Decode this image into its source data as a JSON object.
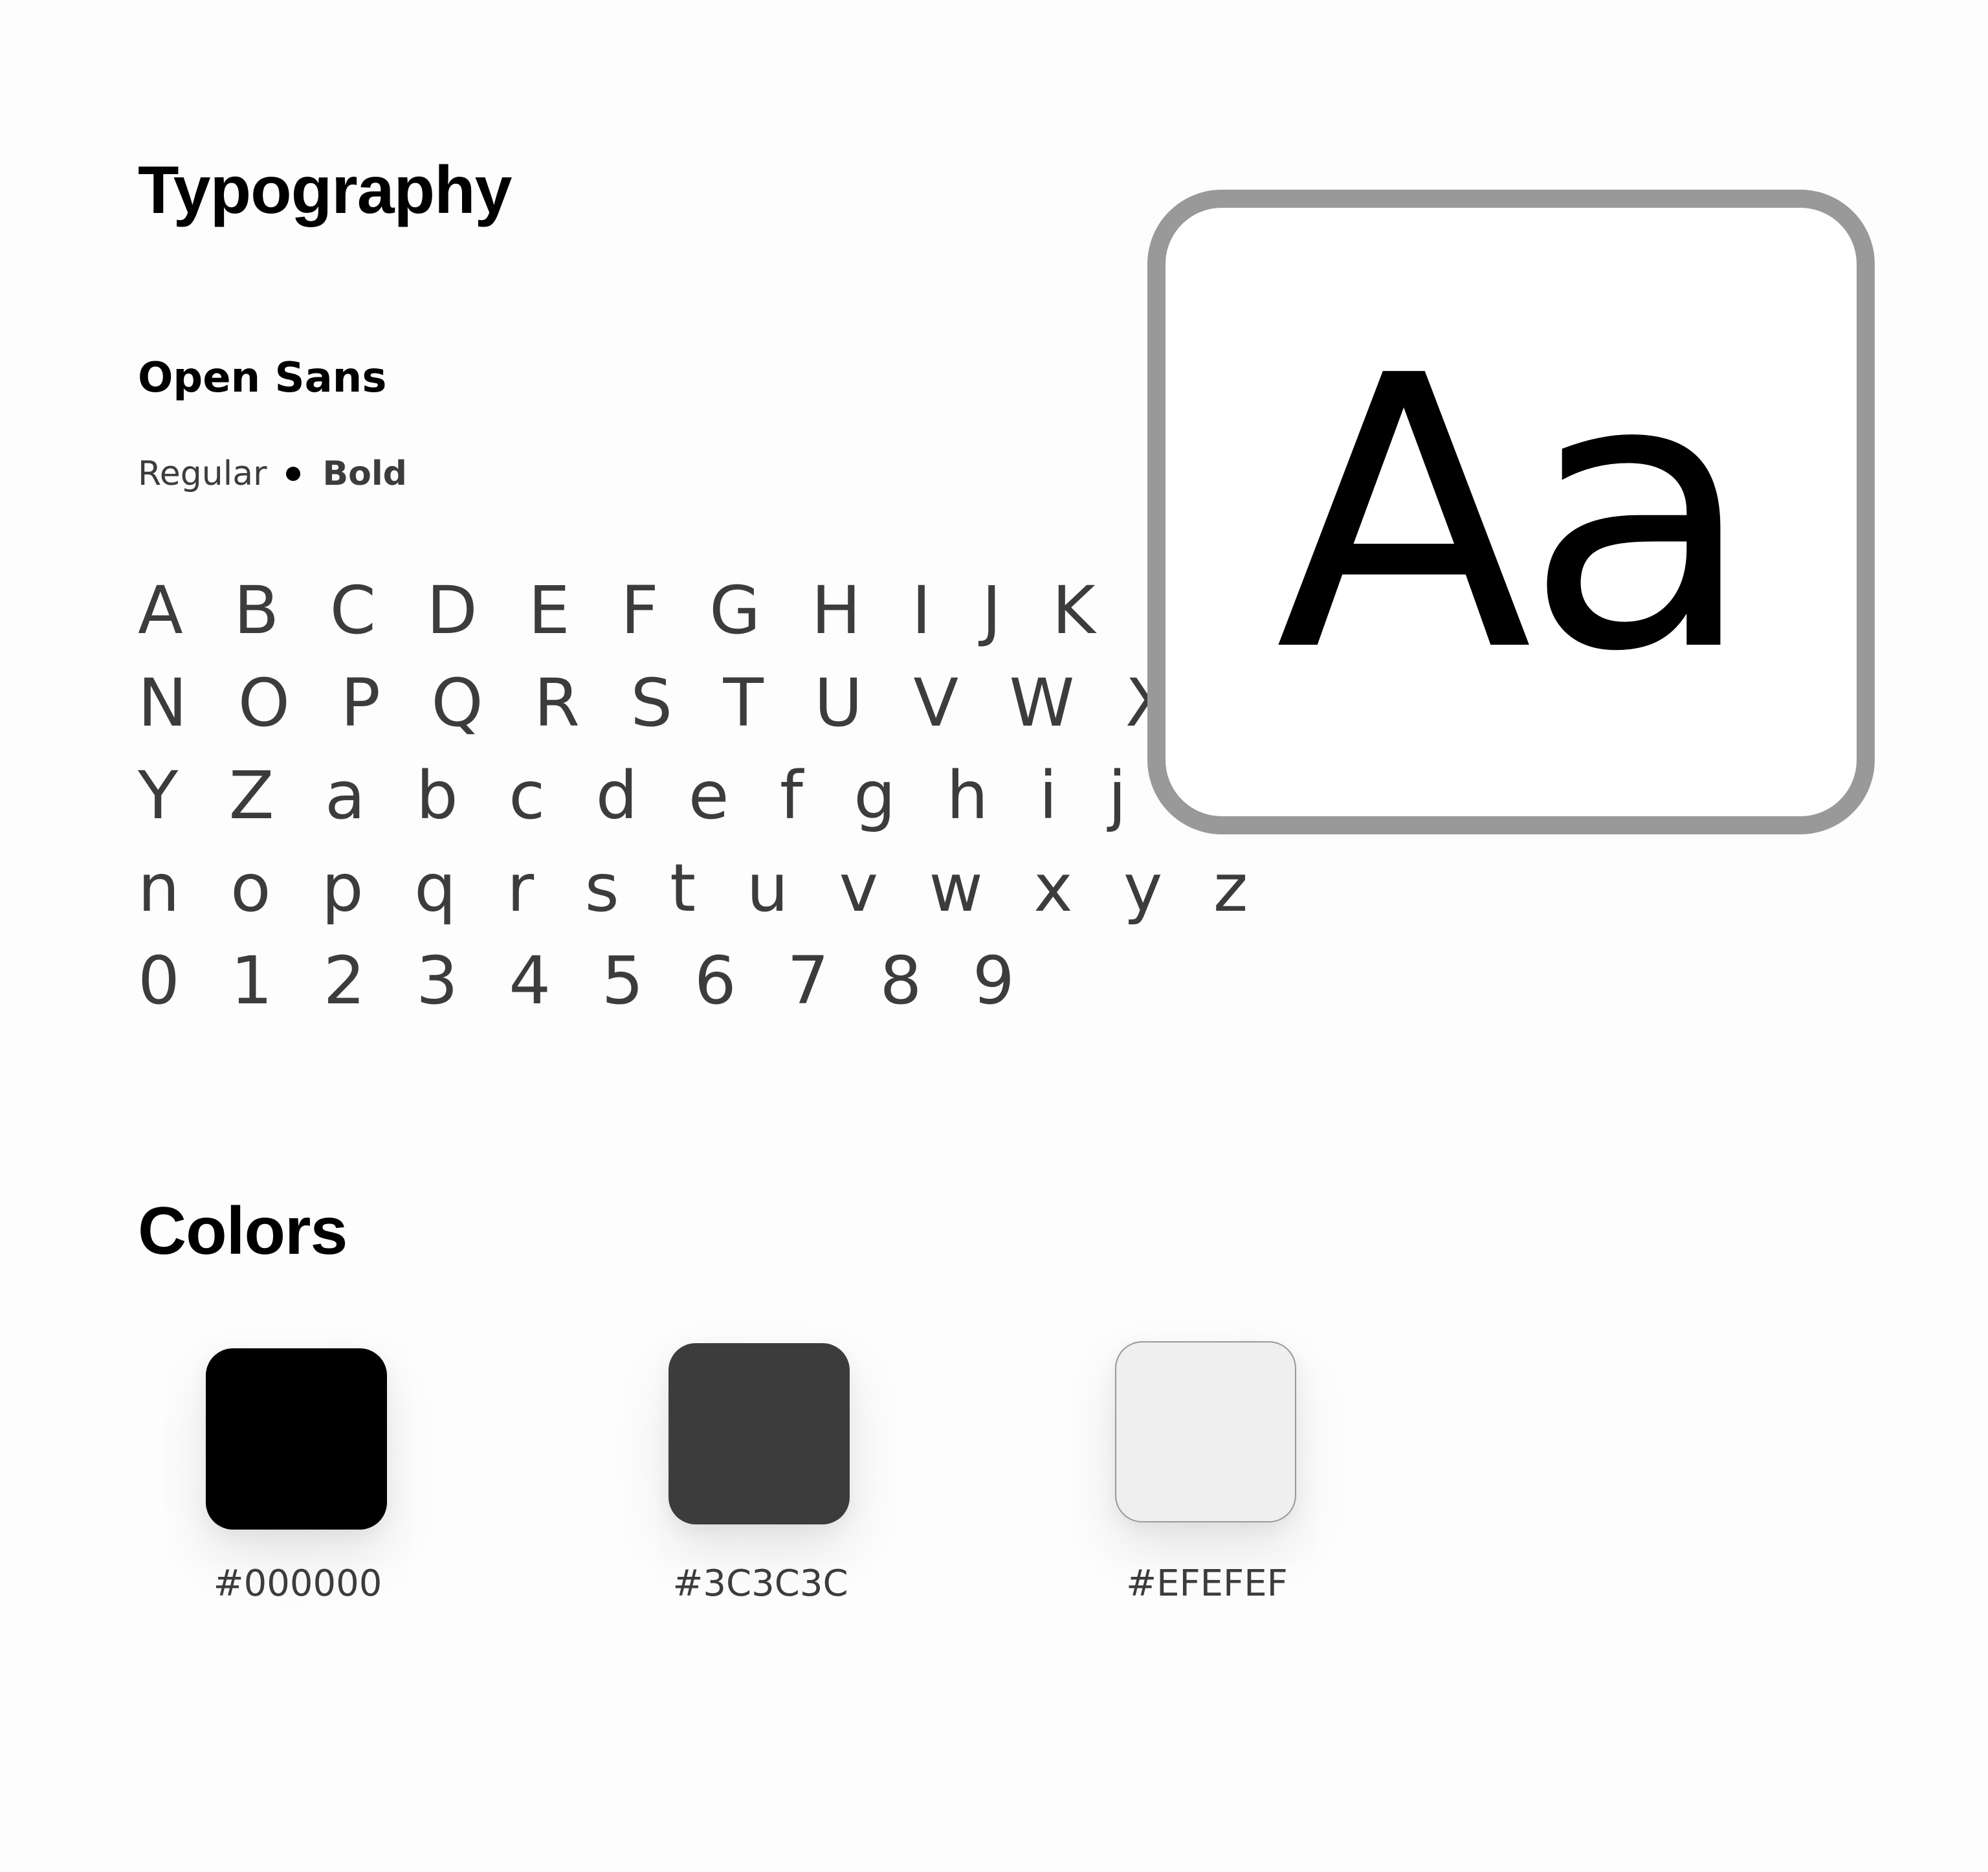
{
  "typography": {
    "title": "Typography",
    "font_name": "Open Sans",
    "weights": {
      "regular": "Regular",
      "bold": "Bold"
    },
    "glyph_lines": [
      "A B C D E F G H I J K L M",
      "N O P Q R S T U V W X",
      "Y Z a b c d e f g h i j k l m",
      "n o p q r s t u v w x y z",
      "0 1 2 3 4 5 6 7 8 9"
    ],
    "specimen": "Aa"
  },
  "colors": {
    "title": "Colors",
    "swatches": [
      {
        "hex": "#000000",
        "color": "#000000"
      },
      {
        "hex": "#3C3C3C",
        "color": "#3C3C3C"
      },
      {
        "hex": "#EFEFEF",
        "color": "#EFEFEF"
      }
    ]
  }
}
